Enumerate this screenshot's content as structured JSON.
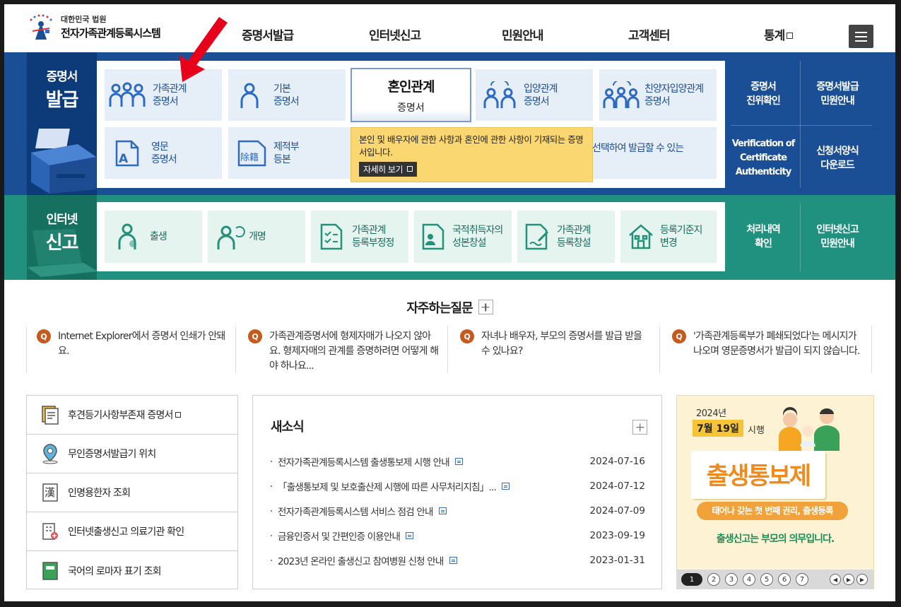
{
  "header": {
    "logo_sub": "대한민국 법원",
    "logo_main": "전자가족관계등록시스템",
    "nav": [
      "증명서발급",
      "인터넷신고",
      "민원안내",
      "고객센터",
      "통계"
    ]
  },
  "certificates": {
    "title_1": "증명서",
    "title_2": "발급",
    "cards": [
      {
        "line1": "가족관계",
        "line2": "증명서"
      },
      {
        "line1": "기본",
        "line2": "증명서"
      },
      {
        "line1": "혼인관계",
        "line2": "증명서"
      },
      {
        "line1": "입양관계",
        "line2": "증명서"
      },
      {
        "line1": "친양자입양관계",
        "line2": "증명서"
      },
      {
        "line1": "영문",
        "line2": "증명서"
      },
      {
        "line1": "제적부",
        "line2": "등본"
      }
    ],
    "hidden_text": "선택하여 발급할 수 있는",
    "tooltip_text": "본인 및 배우자에 관한 사항과 혼인에 관한 사항이 기재되는 증명서입니다.",
    "tooltip_more": "자세히 보기",
    "side_links": [
      {
        "line1": "증명서",
        "line2": "진위확인"
      },
      {
        "line1": "증명서발급",
        "line2": "민원안내"
      },
      {
        "line1": "Verification of",
        "line2": "Certificate",
        "line3": "Authenticity"
      },
      {
        "line1": "신청서양식",
        "line2": "다운로드"
      }
    ]
  },
  "report": {
    "title_1": "인터넷",
    "title_2": "신고",
    "cards": [
      {
        "line1": "출생",
        "line2": ""
      },
      {
        "line1": "개명",
        "line2": ""
      },
      {
        "line1": "가족관계",
        "line2": "등록부정정"
      },
      {
        "line1": "국적취득자의",
        "line2": "성본창설"
      },
      {
        "line1": "가족관계",
        "line2": "등록창설"
      },
      {
        "line1": "등록기준지",
        "line2": "변경"
      }
    ],
    "side_links": [
      {
        "line1": "처리내역",
        "line2": "확인"
      },
      {
        "line1": "인터넷신고",
        "line2": "민원안내"
      }
    ]
  },
  "faq": {
    "title": "자주하는질문",
    "items": [
      "Internet Explorer에서 증명서 인쇄가 안돼요.",
      "가족관계증명서에 형제자매가 나오지 않아요. 형제자매의 관계를 증명하려면 어떻게 해야 하나요...",
      "자녀나 배우자, 부모의 증명서를 발급 받을 수 있나요?",
      "'가족관계등록부가 폐쇄되었다'는 메시지가 나오며 영문증명서가 발급이 되지 않습니다."
    ]
  },
  "quick_links": [
    "후견등기사항부존재 증명서",
    "무인증명서발급기 위치",
    "인명용한자 조회",
    "인터넷출생신고 의료기관 확인",
    "국어의 로마자 표기 조회"
  ],
  "news": {
    "title": "새소식",
    "items": [
      {
        "title": "전자가족관계등록시스템 출생통보제 시행 안내",
        "date": "2024-07-16"
      },
      {
        "title": "「출생통보제 및 보호출산제 시행에 따른 사무처리지침」...",
        "date": "2024-07-12"
      },
      {
        "title": "전자가족관계등록시스템 서비스 점검 안내",
        "date": "2024-07-09"
      },
      {
        "title": "금융인증서 및 간편인증 이용안내",
        "date": "2023-09-19"
      },
      {
        "title": "2023년 온라인 출생신고 참여병원 신청 안내",
        "date": "2023-01-31"
      }
    ]
  },
  "banner": {
    "year": "2024년",
    "date": "7월 19일",
    "date_suffix": "시행",
    "headline": "출생통보제",
    "pill": "태어나 갖는 첫 번째 권리, 출생등록",
    "duty": "출생신고는 부모의 의무입니다.",
    "pages": [
      "1",
      "2",
      "3",
      "4",
      "5",
      "6",
      "7"
    ]
  },
  "colors": {
    "cert_band": "#1a4f95",
    "report_band": "#21917f",
    "tooltip": "#fbd771",
    "accent_red": "#e8001a"
  }
}
